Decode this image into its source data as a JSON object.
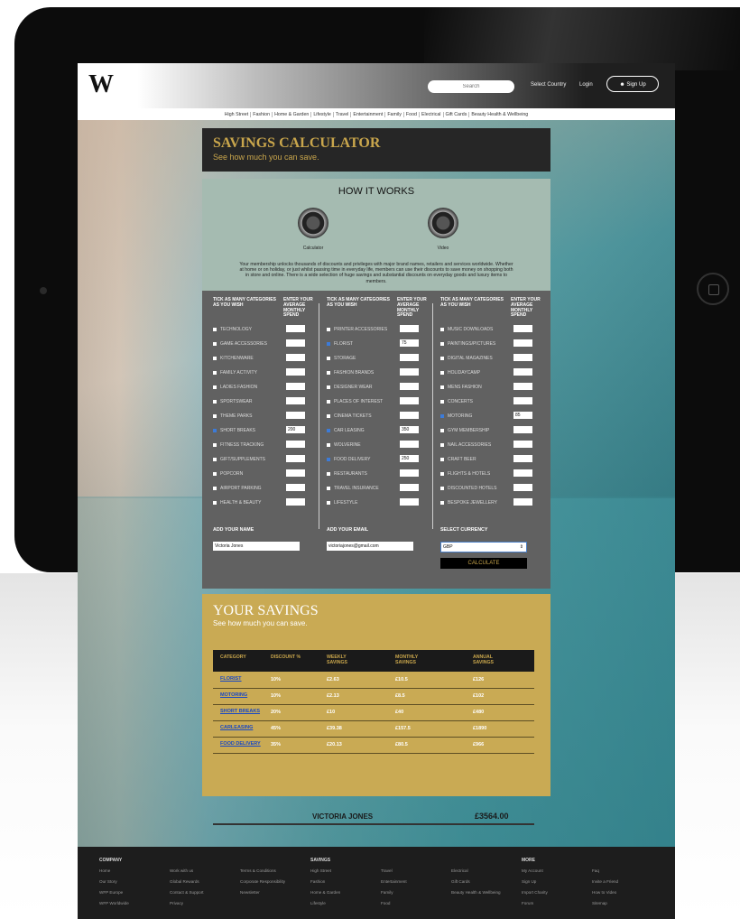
{
  "site": {
    "logo": "W"
  },
  "header": {
    "search_placeholder": "Search",
    "select_country": "Select Country",
    "login": "Login",
    "signup": "Sign Up"
  },
  "nav": [
    "High Street",
    "Fashion",
    "Home & Garden",
    "Lifestyle",
    "Travel",
    "Entertainment",
    "Family",
    "Food",
    "Electrical",
    "Gift Cards",
    "Beauty Health & Wellbeing"
  ],
  "calculator": {
    "title": "SAVINGS CALCULATOR",
    "subtitle": "See how much you can save."
  },
  "how_it_works": {
    "title": "HOW IT WORKS",
    "items": [
      {
        "label": "Calculator",
        "icon": "calculator-icon"
      },
      {
        "label": "Video",
        "icon": "video-icon"
      }
    ],
    "text": "Your membership unlocks thousands of discounts and privileges with major brand names, retailers and services worldwide. Whether at home or on holiday, or just whilst passing time in everyday life, members can use their discounts to save money on shopping both in store and online. There is a wide selection of huge savings and substantial discounts on everyday goods and luxury items to members."
  },
  "categories": {
    "col_header_tick": "TICK AS MANY CATEGORIES AS YOU WISH",
    "col_header_spend": "ENTER YOUR AVERAGE MONTHLY SPEND",
    "columns": [
      [
        {
          "label": "TECHNOLOGY",
          "checked": false,
          "value": ""
        },
        {
          "label": "GAME ACCESSORIES",
          "checked": false,
          "value": ""
        },
        {
          "label": "KITCHENWARE",
          "checked": false,
          "value": ""
        },
        {
          "label": "FAMILY ACTIVITY",
          "checked": false,
          "value": ""
        },
        {
          "label": "LADIES FASHION",
          "checked": false,
          "value": ""
        },
        {
          "label": "SPORTSWEAR",
          "checked": false,
          "value": ""
        },
        {
          "label": "THEME PARKS",
          "checked": false,
          "value": ""
        },
        {
          "label": "SHORT BREAKS",
          "checked": true,
          "value": "200"
        },
        {
          "label": "FITNESS TRACKING",
          "checked": false,
          "value": ""
        },
        {
          "label": "GIFT/SUPPLEMENTS",
          "checked": false,
          "value": ""
        },
        {
          "label": "POPCORN",
          "checked": false,
          "value": ""
        },
        {
          "label": "AIRPORT PARKING",
          "checked": false,
          "value": ""
        },
        {
          "label": "HEALTH & BEAUTY",
          "checked": false,
          "value": ""
        }
      ],
      [
        {
          "label": "PRINTER ACCESSORIES",
          "checked": false,
          "value": ""
        },
        {
          "label": "FLORIST",
          "checked": true,
          "value": "75"
        },
        {
          "label": "STORAGE",
          "checked": false,
          "value": ""
        },
        {
          "label": "FASHION BRANDS",
          "checked": false,
          "value": ""
        },
        {
          "label": "DESIGNER WEAR",
          "checked": false,
          "value": ""
        },
        {
          "label": "PLACES OF INTEREST",
          "checked": false,
          "value": ""
        },
        {
          "label": "CINEMA TICKETS",
          "checked": false,
          "value": ""
        },
        {
          "label": "CAR LEASING",
          "checked": true,
          "value": "350"
        },
        {
          "label": "WOLVERINE",
          "checked": false,
          "value": ""
        },
        {
          "label": "FOOD DELIVERY",
          "checked": true,
          "value": "250"
        },
        {
          "label": "RESTAURANTS",
          "checked": false,
          "value": ""
        },
        {
          "label": "TRAVEL INSURANCE",
          "checked": false,
          "value": ""
        },
        {
          "label": "LIFESTYLE",
          "checked": false,
          "value": ""
        }
      ],
      [
        {
          "label": "MUSIC DOWNLOADS",
          "checked": false,
          "value": ""
        },
        {
          "label": "PAINTINGS/PICTURES",
          "checked": false,
          "value": ""
        },
        {
          "label": "DIGITAL MAGAZINES",
          "checked": false,
          "value": ""
        },
        {
          "label": "HOLIDAYCAMP",
          "checked": false,
          "value": ""
        },
        {
          "label": "MENS FASHION",
          "checked": false,
          "value": ""
        },
        {
          "label": "CONCERTS",
          "checked": false,
          "value": ""
        },
        {
          "label": "MOTORING",
          "checked": true,
          "value": "85"
        },
        {
          "label": "GYM MEMBERSHIP",
          "checked": false,
          "value": ""
        },
        {
          "label": "NAIL ACCESSORIES",
          "checked": false,
          "value": ""
        },
        {
          "label": "CRAFT BEER",
          "checked": false,
          "value": ""
        },
        {
          "label": "FLIGHTS & HOTELS",
          "checked": false,
          "value": ""
        },
        {
          "label": "DISCOUNTED HOTELS",
          "checked": false,
          "value": ""
        },
        {
          "label": "BESPOKE JEWELLERY",
          "checked": false,
          "value": ""
        }
      ]
    ]
  },
  "form": {
    "name_label": "ADD YOUR NAME",
    "name_value": "Victoria Jones",
    "email_label": "ADD YOUR EMAIL",
    "email_value": "victoriajones@gmail.com",
    "currency_label": "SELECT CURRENCY",
    "currency_value": "GBP",
    "calculate_label": "CALCULATE"
  },
  "savings": {
    "title": "YOUR SAVINGS",
    "subtitle": "See how much you can save.",
    "headers": [
      "CATEGORY",
      "DISCOUNT %",
      "WEEKLY SAVINGS",
      "MONTHLY SAVINGS",
      "ANNUAL SAVINGS"
    ],
    "rows": [
      [
        "FLORIST",
        "10%",
        "£2.63",
        "£10.5",
        "£126"
      ],
      [
        "MOTORING",
        "10%",
        "£2.13",
        "£8.5",
        "£102"
      ],
      [
        "SHORT BREAKS",
        "20%",
        "£10",
        "£40",
        "£480"
      ],
      [
        "CARLEASING",
        "45%",
        "£39.38",
        "£157.5",
        "£1890"
      ],
      [
        "FOOD DELIVERY",
        "35%",
        "£20.13",
        "£80.5",
        "£966"
      ]
    ],
    "total_name": "VICTORIA JONES",
    "total_amount": "£3564.00"
  },
  "footer": {
    "company": {
      "title": "COMPANY",
      "links": [
        "Home",
        "Our Story",
        "WFP Europe",
        "WFP Worldwide",
        "Work with us",
        "Global Rewards",
        "Contact & Support",
        "Privacy",
        "Terms & Conditions",
        "Corporate Responsibility",
        "Newsletter"
      ]
    },
    "savings": {
      "title": "SAVINGS",
      "links": [
        "High Street",
        "Fashion",
        "Home & Garden",
        "Lifestyle",
        "Travel",
        "Entertainment",
        "Family",
        "Food",
        "Electrical",
        "Gift Cards",
        "Beauty Health & Wellbeing"
      ]
    },
    "more": {
      "title": "MORE",
      "links": [
        "My Account",
        "Sign Up",
        "Import Charity",
        "Forum",
        "Faq",
        "Invite a Friend",
        "How to Video",
        "Sitemap"
      ]
    }
  }
}
